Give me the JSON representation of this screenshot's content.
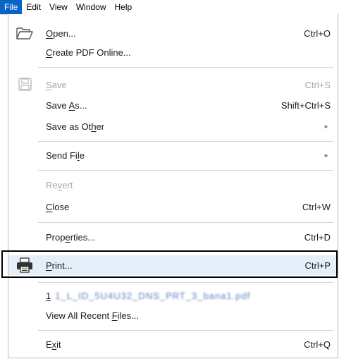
{
  "menubar": {
    "items": [
      "File",
      "Edit",
      "View",
      "Window",
      "Help"
    ],
    "active": "File"
  },
  "menu": {
    "open": {
      "pre": "",
      "ul": "O",
      "post": "pen...",
      "shortcut": "Ctrl+O"
    },
    "create": {
      "pre": "",
      "ul": "C",
      "post": "reate PDF Online..."
    },
    "save": {
      "pre": "",
      "ul": "S",
      "post": "ave",
      "shortcut": "Ctrl+S"
    },
    "saveas": {
      "pre": "Save ",
      "ul": "A",
      "post": "s...",
      "shortcut": "Shift+Ctrl+S"
    },
    "saveother": {
      "pre": "Save as Ot",
      "ul": "h",
      "post": "er",
      "arrow": "►"
    },
    "send": {
      "pre": "Send Fi",
      "ul": "l",
      "post": "e",
      "arrow": "►"
    },
    "revert": {
      "pre": "Re",
      "ul": "v",
      "post": "ert"
    },
    "close": {
      "pre": "",
      "ul": "C",
      "post": "lose",
      "shortcut": "Ctrl+W"
    },
    "props": {
      "pre": "Prop",
      "ul": "e",
      "post": "rties...",
      "shortcut": "Ctrl+D"
    },
    "print": {
      "pre": "",
      "ul": "P",
      "post": "rint...",
      "shortcut": "Ctrl+P"
    },
    "recent1": {
      "num": "1",
      "name": "1_L_ID_5U4U32_DNS_PRT_3_bana1.pdf"
    },
    "viewall": {
      "pre": "View All Recent ",
      "ul": "F",
      "post": "iles..."
    },
    "exit": {
      "pre": "E",
      "ul": "x",
      "post": "it",
      "shortcut": "Ctrl+Q"
    }
  },
  "colors": {
    "menubar_active": "#0a64c8",
    "highlight": "#e5eff9",
    "disabled": "#a6a6a6"
  }
}
